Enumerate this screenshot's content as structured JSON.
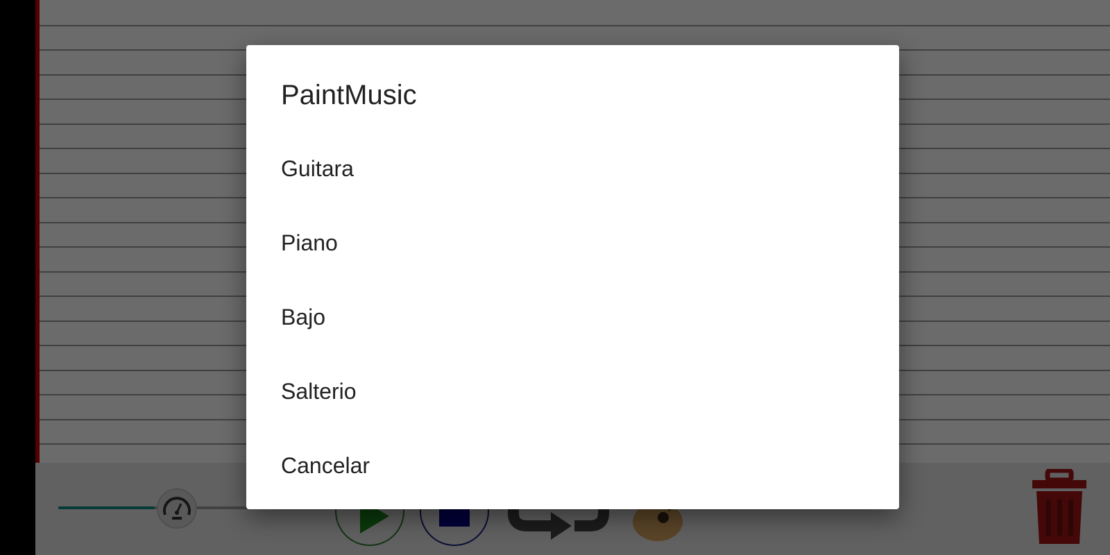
{
  "dialog": {
    "title": "PaintMusic",
    "items": [
      {
        "label": "Guitara"
      },
      {
        "label": "Piano"
      },
      {
        "label": "Bajo"
      },
      {
        "label": "Salterio"
      },
      {
        "label": "Cancelar"
      }
    ]
  },
  "toolbar": {
    "tempo_slider_level": 0.48,
    "icons": [
      "speedometer-icon",
      "play-icon",
      "stop-icon",
      "loop-icon",
      "guitar-icon",
      "trash-icon"
    ]
  },
  "colors": {
    "accent": "#0f8a80",
    "play": "#1b8a1b",
    "stop": "#00008b",
    "trash": "#a31515",
    "playhead": "#c40000"
  }
}
